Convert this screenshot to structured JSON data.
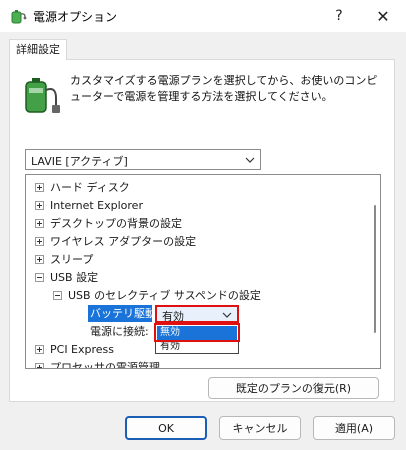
{
  "window": {
    "title": "電源オプション",
    "help_label": "?",
    "close_label": "✕"
  },
  "tabs": [
    {
      "label": "詳細設定",
      "active": true
    }
  ],
  "description": "カスタマイズする電源プランを選択してから、お使いのコンピューターで電源を管理する方法を選択してください。",
  "plan_select": {
    "value": "LAVIE [アクティブ]"
  },
  "tree": {
    "items": [
      {
        "label": "ハード ディスク",
        "expander": "plus"
      },
      {
        "label": "Internet Explorer",
        "expander": "plus"
      },
      {
        "label": "デスクトップの背景の設定",
        "expander": "plus"
      },
      {
        "label": "ワイヤレス アダプターの設定",
        "expander": "plus"
      },
      {
        "label": "スリープ",
        "expander": "plus"
      },
      {
        "label": "USB 設定",
        "expander": "minus"
      },
      {
        "label": "USB のセレクティブ サスペンドの設定",
        "expander": "minus"
      },
      {
        "label": "電源に接続:"
      },
      {
        "label": "PCI Express",
        "expander": "plus"
      },
      {
        "label": "プロセッサの電源管理",
        "expander": "plus"
      }
    ],
    "battery_setting": {
      "label": "バッテリ駆動:",
      "value": "有効",
      "options": [
        "無効",
        "有効"
      ],
      "highlighted_option": "無効"
    }
  },
  "buttons": {
    "restore": "既定のプランの復元(R)",
    "ok": "OK",
    "cancel": "キャンセル",
    "apply": "適用(A)"
  },
  "colors": {
    "selection_blue": "#1a73d9",
    "highlight_red": "#e01010",
    "dialog_bg": "#f0f0f0"
  },
  "icons": {
    "app": "power-options-icon",
    "header": "battery-plug-icon"
  }
}
